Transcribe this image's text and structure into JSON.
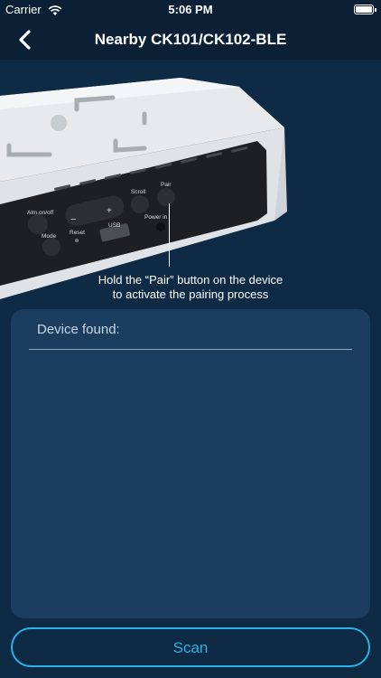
{
  "status_bar": {
    "carrier": "Carrier",
    "time": "5:06 PM"
  },
  "nav": {
    "title": "Nearby CK101/CK102-BLE",
    "back_icon": "chevron-left-icon"
  },
  "device_image": {
    "labels": {
      "alarm": "Alm.on/off",
      "minus": "−",
      "plus": "+",
      "scroll": "Scroll",
      "pair": "Pair",
      "mode": "Mode",
      "reset": "Reset",
      "usb": "USB",
      "power_in": "Power in"
    }
  },
  "hint": {
    "line1": "Hold the “Pair” button on the device",
    "line2": "to activate the pairing process"
  },
  "device_list": {
    "header": "Device found:"
  },
  "scan_button": {
    "label": "Scan"
  },
  "colors": {
    "accent": "#2bb1e8",
    "background": "#0f2a44",
    "panel": "#1b3d60"
  }
}
